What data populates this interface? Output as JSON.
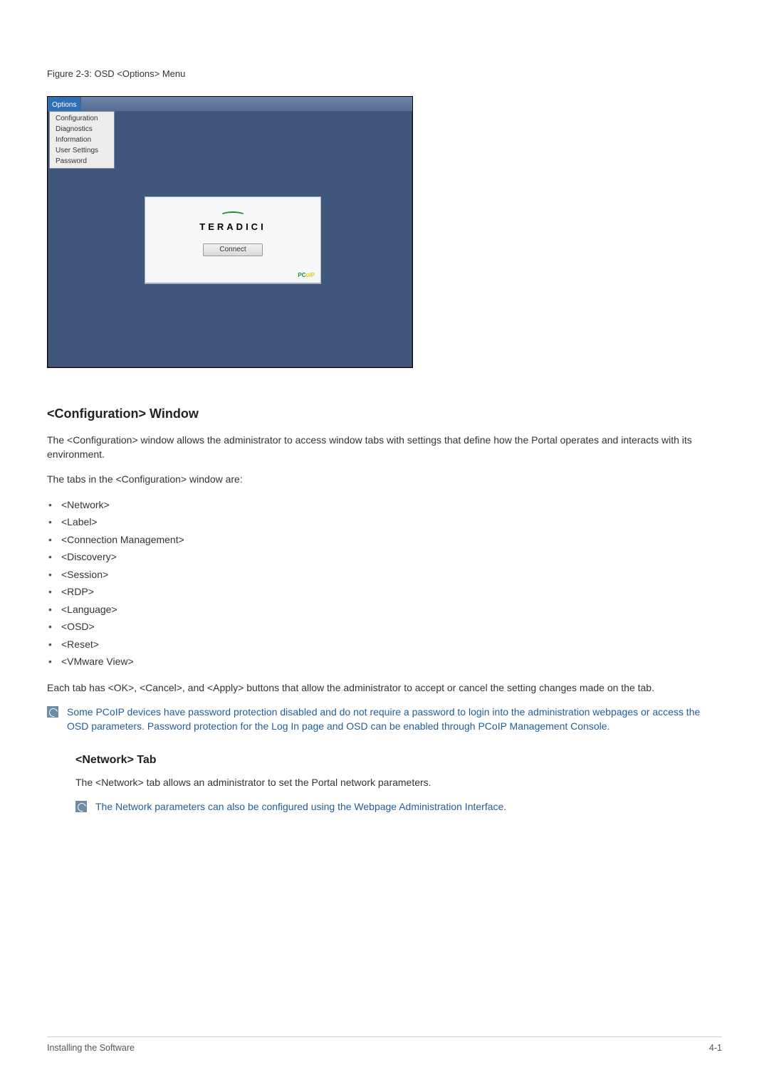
{
  "figure": {
    "caption": "Figure 2-3: OSD <Options> Menu",
    "menubar_label": "Options",
    "menu_items": [
      "Configuration",
      "Diagnostics",
      "Information",
      "User Settings",
      "Password"
    ],
    "logo_text": "TERADICI",
    "connect_label": "Connect",
    "badge_prefix": "PC",
    "badge_suffix": "oIP"
  },
  "section": {
    "heading": "<Configuration> Window",
    "para1": "The <Configuration> window allows the administrator to access window tabs with settings that define how the Portal operates and interacts with its environment.",
    "para2": "The tabs in the <Configuration> window are:",
    "tabs": [
      "<Network>",
      "<Label>",
      "<Connection Management>",
      "<Discovery>",
      "<Session>",
      "<RDP>",
      "<Language>",
      "<OSD>",
      "<Reset>",
      "<VMware View>"
    ],
    "para3": "Each tab has <OK>, <Cancel>, and <Apply> buttons that allow the administrator to accept or cancel the setting changes made on the tab.",
    "note1": "Some PCoIP devices have password protection disabled and do not require a password to login into the administration webpages or access the OSD parameters.  Password protection for the Log In page and OSD can be enabled through PCoIP Management Console."
  },
  "subsection": {
    "heading": "<Network> Tab",
    "para1": "The <Network> tab allows an administrator to set the Portal network parameters.",
    "note1": "The Network parameters can also be configured using the Webpage Administration Interface."
  },
  "footer": {
    "left": "Installing the Software",
    "right": "4-1"
  }
}
